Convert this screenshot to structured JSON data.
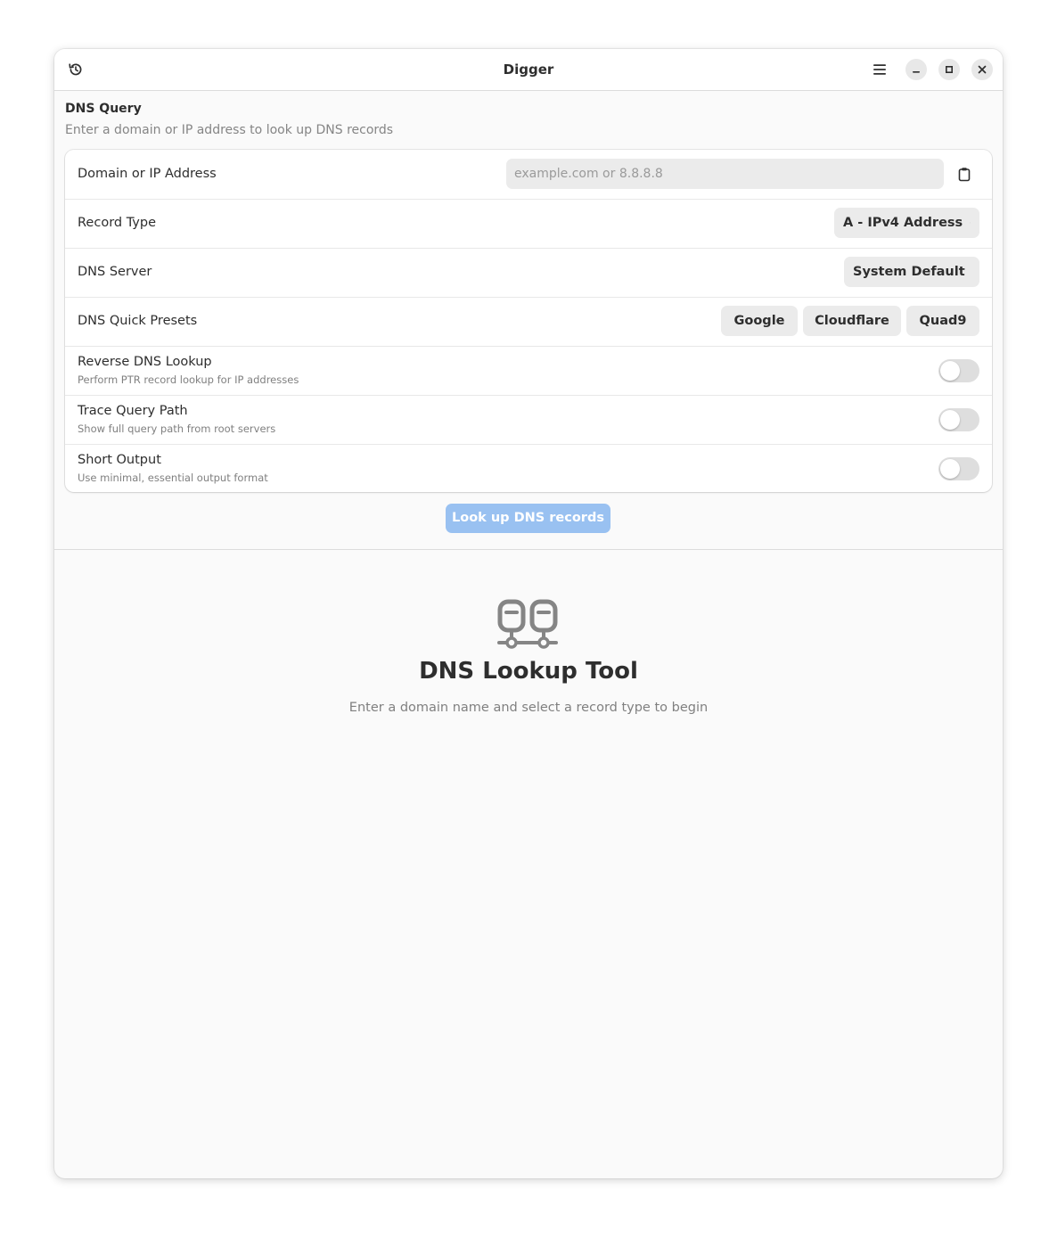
{
  "window": {
    "title": "Digger"
  },
  "header": {
    "icons": [
      "history-icon",
      "hamburger-menu-icon",
      "minimize-icon",
      "maximize-icon",
      "close-icon"
    ]
  },
  "query": {
    "title": "DNS Query",
    "subtitle": "Enter a domain or IP address to look up DNS records",
    "domain": {
      "label": "Domain or IP Address",
      "value": "",
      "placeholder": "example.com or 8.8.8.8",
      "paste_icon": "clipboard-icon"
    },
    "record_type": {
      "label": "Record Type",
      "selected": "A - IPv4 Address"
    },
    "dns_server": {
      "label": "DNS Server",
      "selected": "System Default"
    },
    "presets": {
      "label": "DNS Quick Presets",
      "options": [
        "Google",
        "Cloudflare",
        "Quad9"
      ]
    },
    "toggles": [
      {
        "title": "Reverse DNS Lookup",
        "subtitle": "Perform PTR record lookup for IP addresses",
        "on": false
      },
      {
        "title": "Trace Query Path",
        "subtitle": "Show full query path from root servers",
        "on": false
      },
      {
        "title": "Short Output",
        "subtitle": "Use minimal, essential output format",
        "on": false
      }
    ],
    "lookup_button": "Look up DNS records"
  },
  "status": {
    "icon": "dns-network-icon",
    "title": "DNS Lookup Tool",
    "description": "Enter a domain name and select a record type to begin"
  },
  "colors": {
    "accent_disabled": "#99c1f1",
    "text": "#2e2e2e",
    "dim_text": "#808080"
  }
}
